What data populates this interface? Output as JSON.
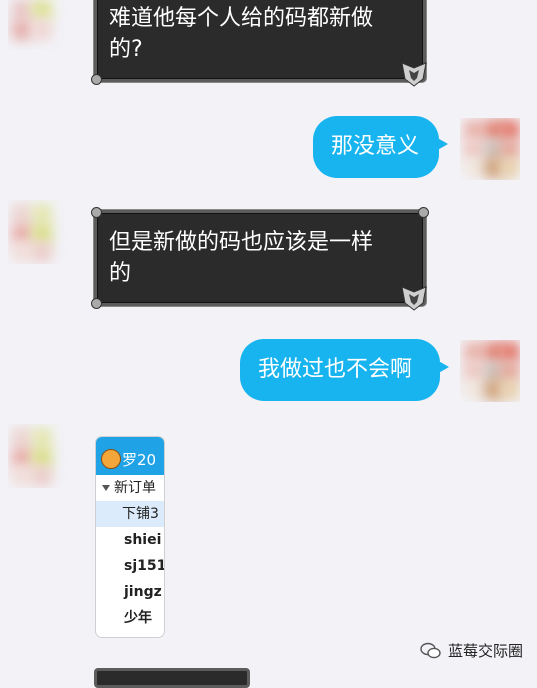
{
  "messages": [
    {
      "side": "left",
      "style": "dark",
      "lines": [
        "难道他每个人给的码都新做",
        "的?"
      ]
    },
    {
      "side": "right",
      "style": "blue",
      "text": "那没意义"
    },
    {
      "side": "left",
      "style": "dark",
      "lines": [
        "但是新做的码也应该是一样",
        "的"
      ]
    },
    {
      "side": "right",
      "style": "blue",
      "text": "我做过也不会啊"
    }
  ],
  "shared_image": {
    "title": "罗20",
    "group": "新订单",
    "selected": "下铺3",
    "users": [
      "shiei",
      "sj151",
      "jingz",
      "少年"
    ]
  },
  "watermark": {
    "text": "蓝莓交际圈",
    "icon": "wechat-icon"
  },
  "colors": {
    "blue_bubble": "#18b4ef",
    "dark_bubble": "#2b2b2b",
    "background": "#f2f2f7"
  }
}
